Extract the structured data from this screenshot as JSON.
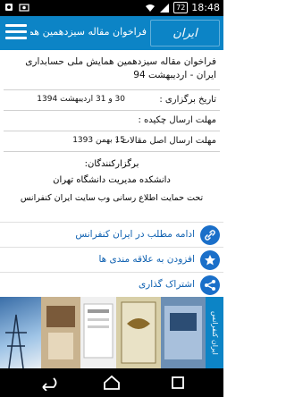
{
  "status_bar": {
    "time": "18:48",
    "battery_percent": "72",
    "icons": [
      "notification-icon",
      "wifi-icon",
      "cell-signal-icon",
      "battery-icon"
    ]
  },
  "app_bar": {
    "title": "فراخوان مقاله  سیزدهمین هم...",
    "logo_text": "ایران کنفرانس"
  },
  "event": {
    "title": "فراخوان مقاله  سیزدهمین همایش ملی حسابداری ایران - اردیبهشت 94",
    "rows": [
      {
        "label": "تاریخ برگزاری :",
        "value": "30 و 31 اردیبهشت 1394"
      },
      {
        "label": "مهلت ارسال چکیده :",
        "value": ""
      },
      {
        "label": "مهلت ارسال اصل مقالات :",
        "value": "15 بهمن 1393"
      }
    ],
    "organizers_title": "برگزارکنندگان:",
    "organizer": "دانشکده مدیریت دانشگاه تهران",
    "support_text": "تحت حمایت اطلاع رسانی وب سایت ایران کنفرانس"
  },
  "actions": [
    {
      "label": "ادامه مطلب در ایران کنفرانس",
      "icon": "link-icon"
    },
    {
      "label": "افزودن به علاقه مندی ها",
      "icon": "star-icon"
    },
    {
      "label": "اشتراک گذاری",
      "icon": "share-icon"
    }
  ],
  "banner": {
    "tag_text": "ایران کنفرانس"
  },
  "colors": {
    "app_bar": "#0c84c6",
    "action_icon": "#1a6fc9",
    "action_text": "#0c5fb0"
  }
}
